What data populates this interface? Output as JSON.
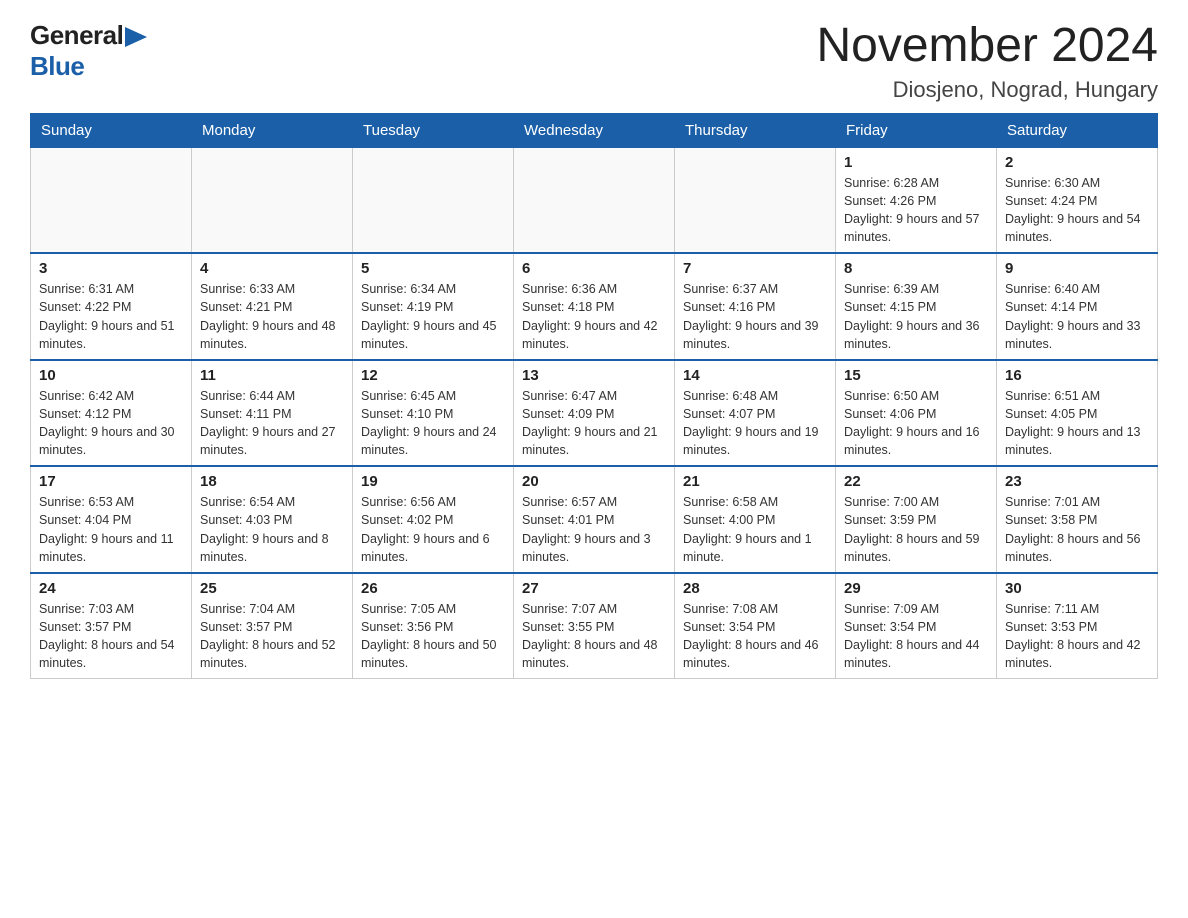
{
  "header": {
    "logo_general": "General",
    "logo_blue": "Blue",
    "month_title": "November 2024",
    "location": "Diosjeno, Nograd, Hungary"
  },
  "days_of_week": [
    "Sunday",
    "Monday",
    "Tuesday",
    "Wednesday",
    "Thursday",
    "Friday",
    "Saturday"
  ],
  "weeks": [
    [
      {
        "day": "",
        "info": ""
      },
      {
        "day": "",
        "info": ""
      },
      {
        "day": "",
        "info": ""
      },
      {
        "day": "",
        "info": ""
      },
      {
        "day": "",
        "info": ""
      },
      {
        "day": "1",
        "info": "Sunrise: 6:28 AM\nSunset: 4:26 PM\nDaylight: 9 hours and 57 minutes."
      },
      {
        "day": "2",
        "info": "Sunrise: 6:30 AM\nSunset: 4:24 PM\nDaylight: 9 hours and 54 minutes."
      }
    ],
    [
      {
        "day": "3",
        "info": "Sunrise: 6:31 AM\nSunset: 4:22 PM\nDaylight: 9 hours and 51 minutes."
      },
      {
        "day": "4",
        "info": "Sunrise: 6:33 AM\nSunset: 4:21 PM\nDaylight: 9 hours and 48 minutes."
      },
      {
        "day": "5",
        "info": "Sunrise: 6:34 AM\nSunset: 4:19 PM\nDaylight: 9 hours and 45 minutes."
      },
      {
        "day": "6",
        "info": "Sunrise: 6:36 AM\nSunset: 4:18 PM\nDaylight: 9 hours and 42 minutes."
      },
      {
        "day": "7",
        "info": "Sunrise: 6:37 AM\nSunset: 4:16 PM\nDaylight: 9 hours and 39 minutes."
      },
      {
        "day": "8",
        "info": "Sunrise: 6:39 AM\nSunset: 4:15 PM\nDaylight: 9 hours and 36 minutes."
      },
      {
        "day": "9",
        "info": "Sunrise: 6:40 AM\nSunset: 4:14 PM\nDaylight: 9 hours and 33 minutes."
      }
    ],
    [
      {
        "day": "10",
        "info": "Sunrise: 6:42 AM\nSunset: 4:12 PM\nDaylight: 9 hours and 30 minutes."
      },
      {
        "day": "11",
        "info": "Sunrise: 6:44 AM\nSunset: 4:11 PM\nDaylight: 9 hours and 27 minutes."
      },
      {
        "day": "12",
        "info": "Sunrise: 6:45 AM\nSunset: 4:10 PM\nDaylight: 9 hours and 24 minutes."
      },
      {
        "day": "13",
        "info": "Sunrise: 6:47 AM\nSunset: 4:09 PM\nDaylight: 9 hours and 21 minutes."
      },
      {
        "day": "14",
        "info": "Sunrise: 6:48 AM\nSunset: 4:07 PM\nDaylight: 9 hours and 19 minutes."
      },
      {
        "day": "15",
        "info": "Sunrise: 6:50 AM\nSunset: 4:06 PM\nDaylight: 9 hours and 16 minutes."
      },
      {
        "day": "16",
        "info": "Sunrise: 6:51 AM\nSunset: 4:05 PM\nDaylight: 9 hours and 13 minutes."
      }
    ],
    [
      {
        "day": "17",
        "info": "Sunrise: 6:53 AM\nSunset: 4:04 PM\nDaylight: 9 hours and 11 minutes."
      },
      {
        "day": "18",
        "info": "Sunrise: 6:54 AM\nSunset: 4:03 PM\nDaylight: 9 hours and 8 minutes."
      },
      {
        "day": "19",
        "info": "Sunrise: 6:56 AM\nSunset: 4:02 PM\nDaylight: 9 hours and 6 minutes."
      },
      {
        "day": "20",
        "info": "Sunrise: 6:57 AM\nSunset: 4:01 PM\nDaylight: 9 hours and 3 minutes."
      },
      {
        "day": "21",
        "info": "Sunrise: 6:58 AM\nSunset: 4:00 PM\nDaylight: 9 hours and 1 minute."
      },
      {
        "day": "22",
        "info": "Sunrise: 7:00 AM\nSunset: 3:59 PM\nDaylight: 8 hours and 59 minutes."
      },
      {
        "day": "23",
        "info": "Sunrise: 7:01 AM\nSunset: 3:58 PM\nDaylight: 8 hours and 56 minutes."
      }
    ],
    [
      {
        "day": "24",
        "info": "Sunrise: 7:03 AM\nSunset: 3:57 PM\nDaylight: 8 hours and 54 minutes."
      },
      {
        "day": "25",
        "info": "Sunrise: 7:04 AM\nSunset: 3:57 PM\nDaylight: 8 hours and 52 minutes."
      },
      {
        "day": "26",
        "info": "Sunrise: 7:05 AM\nSunset: 3:56 PM\nDaylight: 8 hours and 50 minutes."
      },
      {
        "day": "27",
        "info": "Sunrise: 7:07 AM\nSunset: 3:55 PM\nDaylight: 8 hours and 48 minutes."
      },
      {
        "day": "28",
        "info": "Sunrise: 7:08 AM\nSunset: 3:54 PM\nDaylight: 8 hours and 46 minutes."
      },
      {
        "day": "29",
        "info": "Sunrise: 7:09 AM\nSunset: 3:54 PM\nDaylight: 8 hours and 44 minutes."
      },
      {
        "day": "30",
        "info": "Sunrise: 7:11 AM\nSunset: 3:53 PM\nDaylight: 8 hours and 42 minutes."
      }
    ]
  ]
}
